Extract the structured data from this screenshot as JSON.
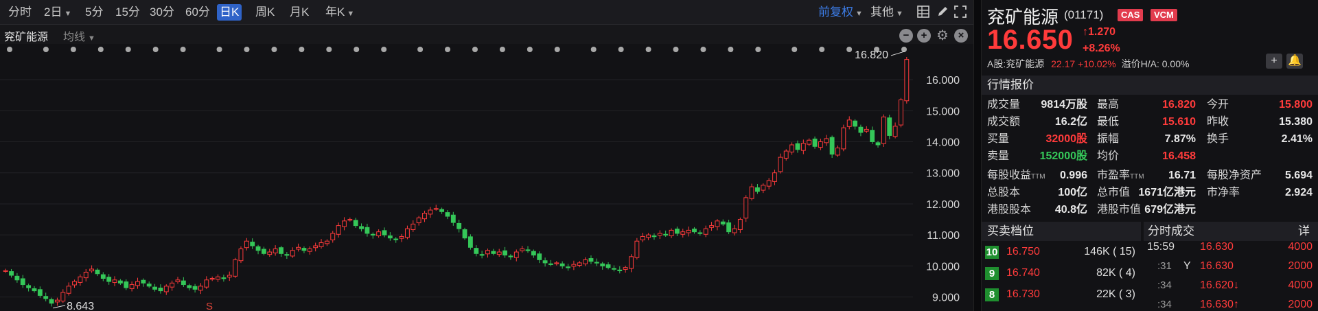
{
  "toolbar": {
    "timeframes": [
      "分时",
      "2日",
      "5分",
      "15分",
      "30分",
      "60分",
      "日K",
      "周K",
      "月K",
      "年K"
    ],
    "active": "日K",
    "adjust": "前复权",
    "more": "其他"
  },
  "subbar": {
    "name": "兖矿能源",
    "ma": "均线"
  },
  "chart_data": {
    "type": "candlestick",
    "title": "",
    "y_ticks": [
      "16.000",
      "15.000",
      "14.000",
      "13.000",
      "12.000",
      "11.000",
      "10.000",
      "9.000"
    ],
    "ylim": [
      8.55,
      17.15
    ],
    "max_label": "16.820",
    "min_label": "8.643",
    "marker": "S",
    "colors": {
      "up": "#ff3b3b",
      "down": "#35c759"
    },
    "candles_close": [
      9.85,
      9.7,
      9.55,
      9.4,
      9.3,
      9.2,
      9.05,
      8.95,
      8.8,
      8.9,
      9.15,
      9.35,
      9.5,
      9.65,
      9.8,
      9.9,
      9.75,
      9.6,
      9.5,
      9.55,
      9.45,
      9.3,
      9.4,
      9.5,
      9.45,
      9.35,
      9.25,
      9.2,
      9.35,
      9.45,
      9.55,
      9.4,
      9.3,
      9.25,
      9.35,
      9.55,
      9.6,
      9.65,
      9.6,
      9.7,
      10.2,
      10.55,
      10.8,
      10.65,
      10.5,
      10.4,
      10.45,
      10.55,
      10.4,
      10.35,
      10.5,
      10.6,
      10.5,
      10.55,
      10.65,
      10.75,
      10.8,
      11.05,
      11.3,
      11.45,
      11.5,
      11.3,
      11.2,
      11.05,
      11.0,
      11.1,
      11.0,
      10.9,
      10.85,
      10.95,
      11.2,
      11.35,
      11.55,
      11.7,
      11.8,
      11.85,
      11.75,
      11.6,
      11.4,
      11.2,
      10.9,
      10.6,
      10.4,
      10.35,
      10.5,
      10.4,
      10.45,
      10.35,
      10.3,
      10.45,
      10.55,
      10.5,
      10.35,
      10.2,
      10.1,
      10.05,
      10.1,
      10.0,
      9.95,
      10.05,
      10.1,
      10.2,
      10.15,
      10.1,
      10.0,
      9.95,
      9.9,
      9.85,
      9.95,
      10.3,
      10.8,
      10.95,
      11.0,
      10.95,
      11.05,
      11.0,
      11.15,
      11.05,
      11.1,
      11.15,
      11.1,
      11.05,
      11.2,
      11.3,
      11.45,
      11.35,
      11.1,
      11.2,
      11.5,
      12.2,
      12.55,
      12.4,
      12.6,
      12.75,
      13.0,
      13.5,
      13.7,
      13.9,
      13.75,
      13.95,
      14.05,
      13.85,
      14.0,
      14.1,
      13.6,
      13.8,
      14.45,
      14.7,
      14.5,
      14.3,
      14.4,
      14.0,
      13.9,
      14.8,
      14.2,
      14.5,
      15.35,
      16.65
    ],
    "dot_count": 32
  },
  "quote": {
    "name": "兖矿能源",
    "code": "(01171)",
    "tags": [
      "CAS",
      "VCM"
    ],
    "price": "16.650",
    "change": "↑1.270",
    "change_pct": "+8.26%",
    "a_share_label": "A股:兖矿能源",
    "a_share_price": "22.17",
    "a_share_pct": "+10.02%",
    "premium": "溢价H/A: 0.00%"
  },
  "market_section": "行情报价",
  "stats_col1": [
    {
      "k": "成交量",
      "v": "9814万股"
    },
    {
      "k": "成交额",
      "v": "16.2亿"
    },
    {
      "k": "买量",
      "v": "32000股"
    },
    {
      "k": "卖量",
      "v": "152000股"
    }
  ],
  "stats_col2": [
    {
      "k": "最高",
      "v": "16.820"
    },
    {
      "k": "最低",
      "v": "15.610"
    },
    {
      "k": "振幅",
      "v": "7.87%"
    },
    {
      "k": "均价",
      "v": "16.458"
    }
  ],
  "stats_col3": [
    {
      "k": "今开",
      "v": "15.800"
    },
    {
      "k": "昨收",
      "v": "15.380"
    },
    {
      "k": "换手",
      "v": "2.41%"
    }
  ],
  "fund": [
    {
      "k": "每股收益",
      "sub": "TTM",
      "v": "0.996"
    },
    {
      "k": "市盈率",
      "sub": "TTM",
      "v": "16.71"
    },
    {
      "k": "每股净资产",
      "sub": "",
      "v": "5.694"
    },
    {
      "k": "总股本",
      "sub": "",
      "v": "100亿"
    },
    {
      "k": "总市值",
      "sub": "",
      "v": "1671亿港元"
    },
    {
      "k": "市净率",
      "sub": "",
      "v": "2.924"
    },
    {
      "k": "港股股本",
      "sub": "",
      "v": "40.8亿"
    },
    {
      "k": "港股市值",
      "sub": "",
      "v": "679亿港元"
    }
  ],
  "orderbook": {
    "title": "买卖档位",
    "rows": [
      {
        "level": "10",
        "price": "16.750",
        "vol": "146K ( 15)"
      },
      {
        "level": "9",
        "price": "16.740",
        "vol": "82K ( 4)"
      },
      {
        "level": "8",
        "price": "16.730",
        "vol": "22K ( 3)"
      }
    ]
  },
  "ticks": {
    "title": "分时成交",
    "detail": "详",
    "rows": [
      {
        "time": "15:59",
        "flag": "",
        "price": "16.630",
        "vol": "4000"
      },
      {
        "time": ":31",
        "flag": "Y",
        "price": "16.630",
        "vol": "2000"
      },
      {
        "time": ":34",
        "flag": "",
        "price": "16.620↓",
        "vol": "4000"
      },
      {
        "time": ":34",
        "flag": "",
        "price": "16.630↑",
        "vol": "2000"
      }
    ]
  }
}
